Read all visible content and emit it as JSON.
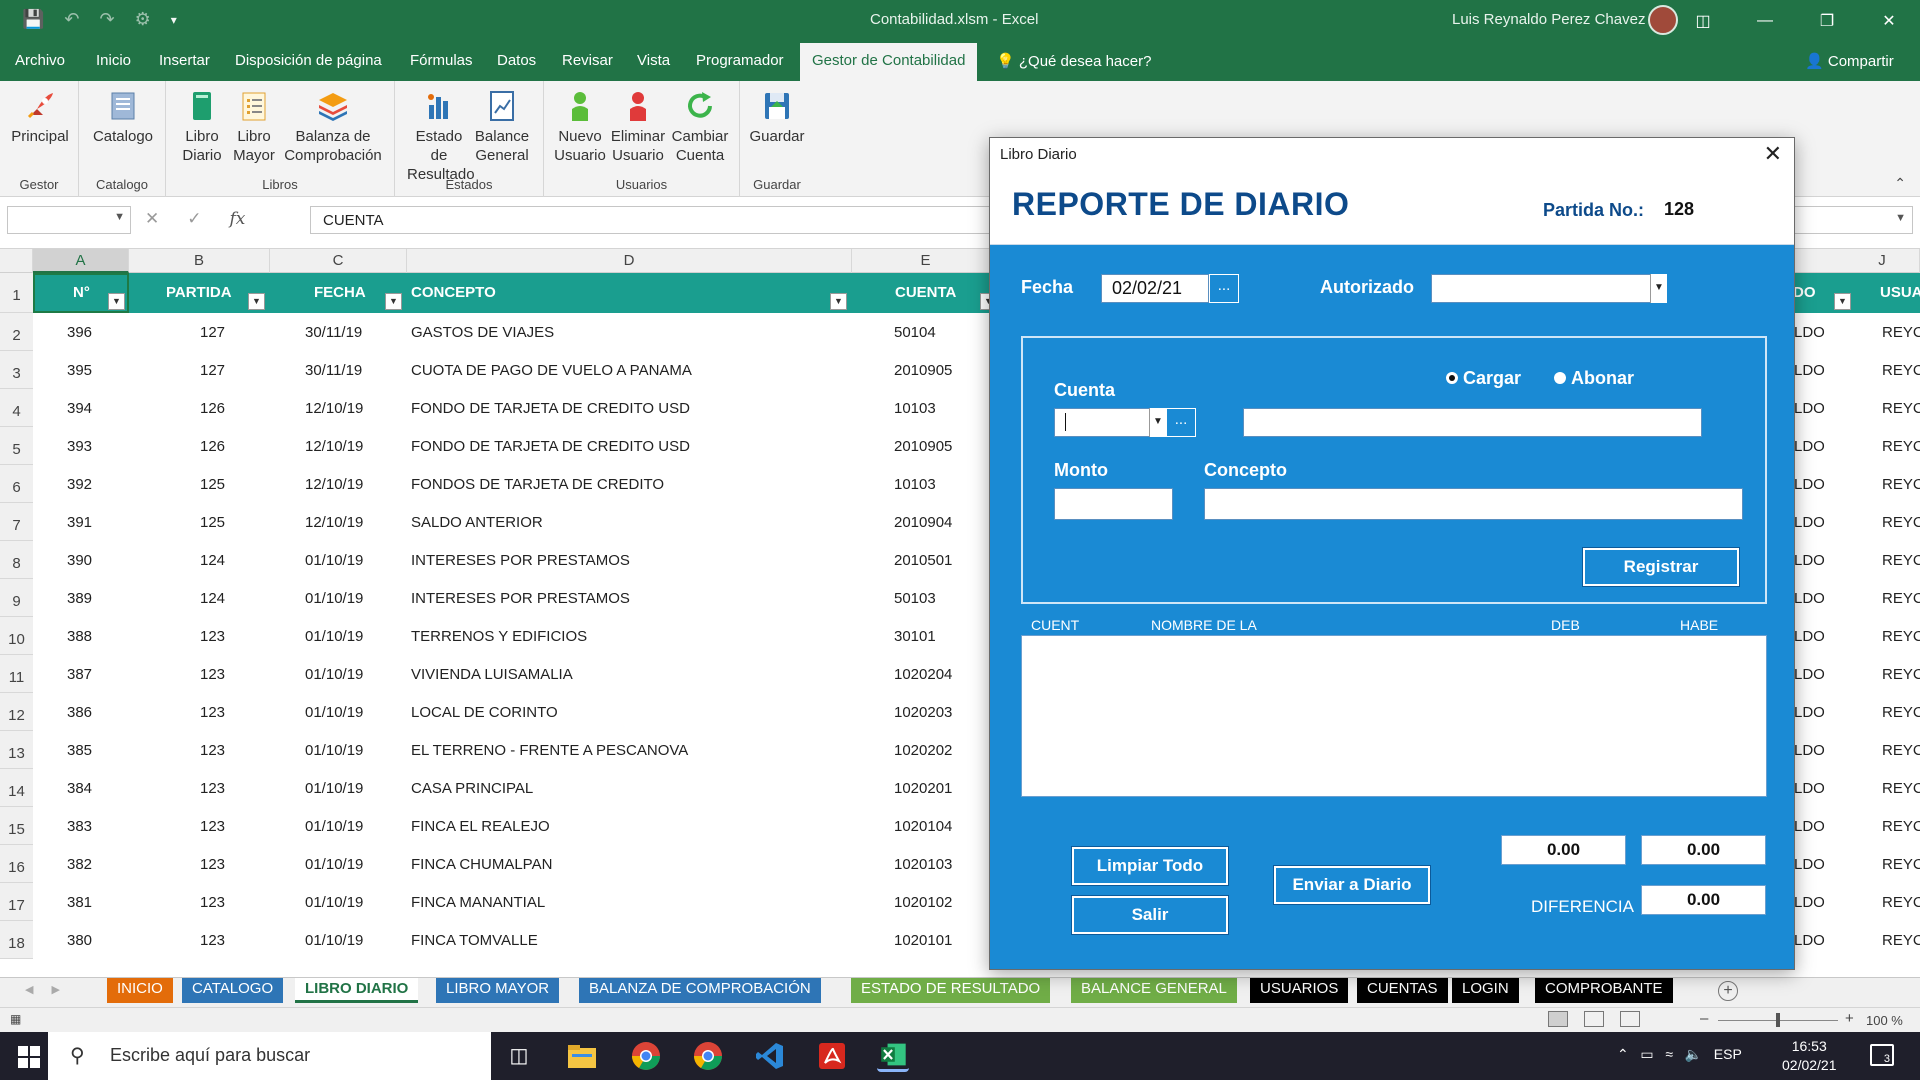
{
  "window": {
    "title": "Contabilidad.xlsm  -  Excel",
    "user": "Luis Reynaldo Perez Chavez"
  },
  "ribbon_tabs": [
    "Archivo",
    "Inicio",
    "Insertar",
    "Disposición de página",
    "Fórmulas",
    "Datos",
    "Revisar",
    "Vista",
    "Programador",
    "Gestor de Contabilidad"
  ],
  "tell_me": "¿Qué desea hacer?",
  "share": "Compartir",
  "ribbon": {
    "groups": [
      {
        "label": "Gestor",
        "buttons": [
          {
            "line1": "Principal",
            "line2": "",
            "icon": "rocket-icon"
          }
        ]
      },
      {
        "label": "Catalogo",
        "buttons": [
          {
            "line1": "Catalogo",
            "line2": "",
            "icon": "catalog-icon"
          }
        ]
      },
      {
        "label": "Libros",
        "buttons": [
          {
            "line1": "Libro",
            "line2": "Diario",
            "icon": "book-icon"
          },
          {
            "line1": "Libro",
            "line2": "Mayor",
            "icon": "ledger-icon"
          },
          {
            "line1": "Balanza de",
            "line2": "Comprobación",
            "icon": "layers-icon"
          }
        ]
      },
      {
        "label": "Estados",
        "buttons": [
          {
            "line1": "Estado de",
            "line2": "Resultado",
            "icon": "bar-chart-icon"
          },
          {
            "line1": "Balance",
            "line2": "General",
            "icon": "report-icon"
          }
        ]
      },
      {
        "label": "Usuarios",
        "buttons": [
          {
            "line1": "Nuevo",
            "line2": "Usuario",
            "icon": "user-add-icon"
          },
          {
            "line1": "Eliminar",
            "line2": "Usuario",
            "icon": "user-remove-icon"
          },
          {
            "line1": "Cambiar",
            "line2": "Cuenta",
            "icon": "refresh-icon"
          }
        ]
      },
      {
        "label": "Guardar",
        "buttons": [
          {
            "line1": "Guardar",
            "line2": "",
            "icon": "save-icon"
          }
        ]
      }
    ]
  },
  "formula_bar": {
    "name_box": "",
    "content": "CUENTA"
  },
  "columns": [
    "A",
    "B",
    "C",
    "D",
    "E",
    "J"
  ],
  "table_header": {
    "n": "N°",
    "partida": "PARTIDA",
    "fecha": "FECHA",
    "concepto": "CONCEPTO",
    "cuenta": "CUENTA",
    "col_do": "DO",
    "col_usua": "USUA"
  },
  "rows": [
    {
      "rn": "2",
      "n": "396",
      "partida": "127",
      "fecha": "30/11/19",
      "concepto": "GASTOS DE VIAJES",
      "cuenta": "50104",
      "do": "LDO",
      "usua": "REYC"
    },
    {
      "rn": "3",
      "n": "395",
      "partida": "127",
      "fecha": "30/11/19",
      "concepto": "CUOTA DE PAGO DE VUELO A PANAMA",
      "cuenta": "2010905",
      "do": "LDO",
      "usua": "REYC"
    },
    {
      "rn": "4",
      "n": "394",
      "partida": "126",
      "fecha": "12/10/19",
      "concepto": "FONDO DE TARJETA DE CREDITO USD",
      "cuenta": "10103",
      "do": "LDO",
      "usua": "REYC"
    },
    {
      "rn": "5",
      "n": "393",
      "partida": "126",
      "fecha": "12/10/19",
      "concepto": "FONDO DE TARJETA DE CREDITO USD",
      "cuenta": "2010905",
      "do": "LDO",
      "usua": "REYC"
    },
    {
      "rn": "6",
      "n": "392",
      "partida": "125",
      "fecha": "12/10/19",
      "concepto": "FONDOS DE TARJETA DE CREDITO",
      "cuenta": "10103",
      "do": "LDO",
      "usua": "REYC"
    },
    {
      "rn": "7",
      "n": "391",
      "partida": "125",
      "fecha": "12/10/19",
      "concepto": "SALDO ANTERIOR",
      "cuenta": "2010904",
      "do": "LDO",
      "usua": "REYC"
    },
    {
      "rn": "8",
      "n": "390",
      "partida": "124",
      "fecha": "01/10/19",
      "concepto": "INTERESES POR PRESTAMOS",
      "cuenta": "2010501",
      "do": "LDO",
      "usua": "REYC"
    },
    {
      "rn": "9",
      "n": "389",
      "partida": "124",
      "fecha": "01/10/19",
      "concepto": "INTERESES POR PRESTAMOS",
      "cuenta": "50103",
      "do": "LDO",
      "usua": "REYC"
    },
    {
      "rn": "10",
      "n": "388",
      "partida": "123",
      "fecha": "01/10/19",
      "concepto": "TERRENOS Y EDIFICIOS",
      "cuenta": "30101",
      "do": "LDO",
      "usua": "REYC"
    },
    {
      "rn": "11",
      "n": "387",
      "partida": "123",
      "fecha": "01/10/19",
      "concepto": "VIVIENDA LUISAMALIA",
      "cuenta": "1020204",
      "do": "LDO",
      "usua": "REYC"
    },
    {
      "rn": "12",
      "n": "386",
      "partida": "123",
      "fecha": "01/10/19",
      "concepto": "LOCAL DE CORINTO",
      "cuenta": "1020203",
      "do": "LDO",
      "usua": "REYC"
    },
    {
      "rn": "13",
      "n": "385",
      "partida": "123",
      "fecha": "01/10/19",
      "concepto": "EL TERRENO - FRENTE A PESCANOVA",
      "cuenta": "1020202",
      "do": "LDO",
      "usua": "REYC"
    },
    {
      "rn": "14",
      "n": "384",
      "partida": "123",
      "fecha": "01/10/19",
      "concepto": "CASA PRINCIPAL",
      "cuenta": "1020201",
      "do": "LDO",
      "usua": "REYC"
    },
    {
      "rn": "15",
      "n": "383",
      "partida": "123",
      "fecha": "01/10/19",
      "concepto": "FINCA EL REALEJO",
      "cuenta": "1020104",
      "do": "LDO",
      "usua": "REYC"
    },
    {
      "rn": "16",
      "n": "382",
      "partida": "123",
      "fecha": "01/10/19",
      "concepto": "FINCA CHUMALPAN",
      "cuenta": "1020103",
      "do": "LDO",
      "usua": "REYC"
    },
    {
      "rn": "17",
      "n": "381",
      "partida": "123",
      "fecha": "01/10/19",
      "concepto": "FINCA MANANTIAL",
      "cuenta": "1020102",
      "do": "LDO",
      "usua": "REYC"
    },
    {
      "rn": "18",
      "n": "380",
      "partida": "123",
      "fecha": "01/10/19",
      "concepto": "FINCA TOMVALLE",
      "cuenta": "1020101",
      "do": "LDO",
      "usua": "REYC"
    }
  ],
  "sheet_tabs": [
    {
      "label": "INICIO",
      "color": "#e36c0a"
    },
    {
      "label": "CATALOGO",
      "color": "#2e75b6"
    },
    {
      "label": "LIBRO DIARIO",
      "color": "#ffffff",
      "active": true
    },
    {
      "label": "LIBRO MAYOR",
      "color": "#2e75b6"
    },
    {
      "label": "BALANZA DE COMPROBACIÓN",
      "color": "#2e75b6"
    },
    {
      "label": "ESTADO DE RESULTADO",
      "color": "#70ad47"
    },
    {
      "label": "BALANCE GENERAL",
      "color": "#70ad47"
    },
    {
      "label": "USUARIOS",
      "color": "#000000"
    },
    {
      "label": "CUENTAS",
      "color": "#000000"
    },
    {
      "label": "LOGIN",
      "color": "#000000"
    },
    {
      "label": "COMPROBANTE",
      "color": "#000000"
    }
  ],
  "status": {
    "zoom": "100 %"
  },
  "taskbar": {
    "search_placeholder": "Escribe aquí para buscar",
    "lang": "ESP",
    "time": "16:53",
    "date": "02/02/21",
    "notifications": "3"
  },
  "dialog": {
    "window_title": "Libro Diario",
    "report_title": "REPORTE DE DIARIO",
    "partida_label": "Partida No.:",
    "partida_value": "128",
    "fecha_label": "Fecha",
    "fecha_value": "02/02/21",
    "autorizado_label": "Autorizado",
    "autorizado_value": "",
    "cargar_label": "Cargar",
    "abonar_label": "Abonar",
    "cargar_selected": true,
    "cuenta_label": "Cuenta",
    "cuenta_value": "",
    "cuenta_name_value": "",
    "monto_label": "Monto",
    "monto_value": "",
    "concepto_label": "Concepto",
    "concepto_value": "",
    "ellipsis": "...",
    "registrar": "Registrar",
    "list_headers": [
      "CUENT",
      "NOMBRE DE LA",
      "DEB",
      "HABE"
    ],
    "limpiar": "Limpiar Todo",
    "salir": "Salir",
    "enviar": "Enviar a Diario",
    "total_debe": "0.00",
    "total_haber": "0.00",
    "diferencia_label": "DIFERENCIA",
    "diferencia_value": "0.00"
  },
  "colors": {
    "excel_green": "#217346",
    "table_header": "#1a9e8f",
    "dialog_blue": "#1a8ad4",
    "title_navy": "#0d4a8a"
  }
}
